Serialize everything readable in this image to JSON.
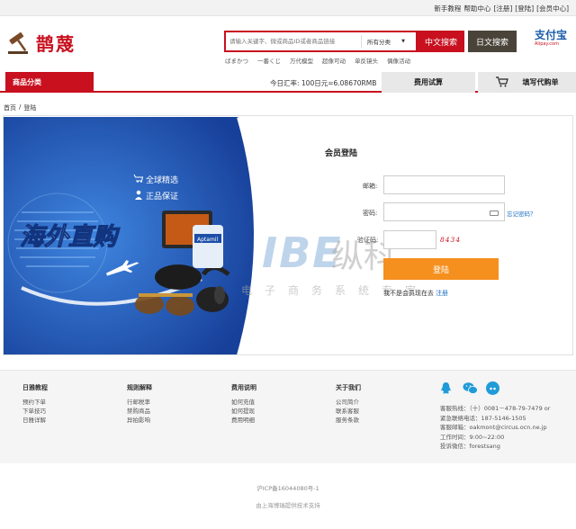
{
  "topbar": {
    "links": [
      "新手教程",
      "帮助中心",
      "[注册]",
      "[登陆]",
      "[会员中心]"
    ]
  },
  "header": {
    "logo_text": "鹊蔑",
    "search_placeholder": "请输入关键字、微或商品ID或者商品链接",
    "search_category": "所有分类",
    "search_cn_label": "中文搜索",
    "search_jp_label": "日文搜索",
    "alipay_cn": "支付宝",
    "alipay_en": "Alipay.com",
    "hot_keywords": [
      "ばまかつ",
      "一番くじ",
      "万代模型",
      "超像可动",
      "单反镜头",
      "偶像活动"
    ]
  },
  "nav": {
    "category_label": "商品分类",
    "exchange_rate": "今日汇率: 100日元=6.08670RMB",
    "fee_trial": "费用试算",
    "fill_order": "填写代购单"
  },
  "breadcrumb": {
    "home": "首页",
    "sep": "/",
    "current": "登陆"
  },
  "banner": {
    "tag1": "全球精选",
    "tag2": "正品保证",
    "headline": "海外直购",
    "product_label": "Aptamil"
  },
  "login": {
    "title": "会员登陆",
    "email_label": "邮箱:",
    "password_label": "密码:",
    "forgot_label": "忘记密码？",
    "captcha_label": "验证码:",
    "captcha_text": "8434",
    "login_button": "登陆",
    "no_account": "我不是会员现在去",
    "register_link": "注册"
  },
  "watermark": {
    "latin": "IBE",
    "cn": "纵科",
    "sub": "电子商务系统专家",
    "reg": "®"
  },
  "footer": {
    "columns": [
      {
        "heading": "日雅教程",
        "items": [
          "预约下单",
          "下单技巧",
          "日雅详解"
        ]
      },
      {
        "heading": "规则解释",
        "items": [
          "行邮税率",
          "禁购商品",
          "异拍影响"
        ]
      },
      {
        "heading": "费用说明",
        "items": [
          "如何充值",
          "如何提现",
          "费用明细"
        ]
      },
      {
        "heading": "关于我们",
        "items": [
          "公司简介",
          "联系客服",
          "服务条款"
        ]
      }
    ],
    "contact": [
      "客服热线：（十）0081－478-79-7479 or",
      "紧急联络电话：187-5146-1505",
      "客服邮箱：oakmont@circus.ocn.ne.jp",
      "工作时间：9:00~22:00",
      "投诉微信：forestsang"
    ],
    "icp": "沪ICP备16044080号-1",
    "tech_support": "由上海博瑞提供技术支持"
  },
  "colors": {
    "brand_red": "#c8101f",
    "login_orange": "#f5901e",
    "banner_blue": "#1d4fa8",
    "link_blue": "#1a6fc2"
  }
}
